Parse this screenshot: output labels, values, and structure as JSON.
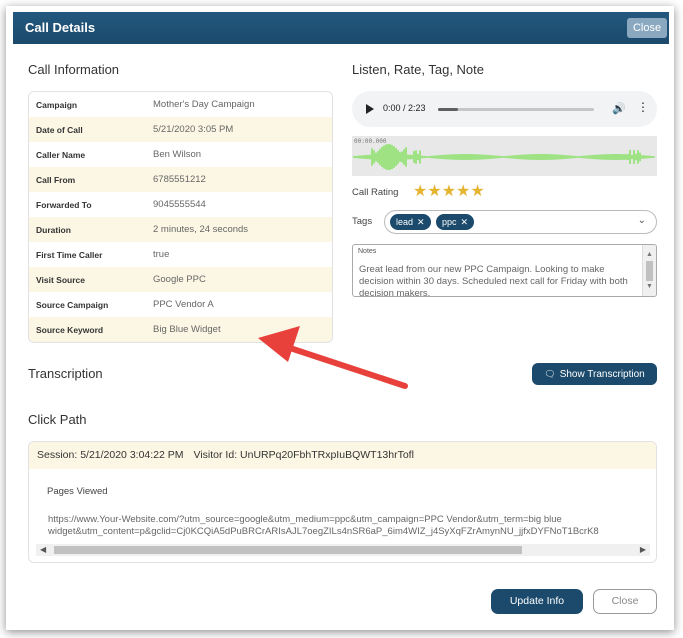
{
  "window": {
    "title": "Call Details",
    "close_label": "Close"
  },
  "call_info": {
    "title": "Call Information",
    "rows": [
      {
        "label": "Campaign",
        "value": "Mother's Day Campaign"
      },
      {
        "label": "Date of Call",
        "value": "5/21/2020 3:05 PM"
      },
      {
        "label": "Caller Name",
        "value": "Ben Wilson"
      },
      {
        "label": "Call From",
        "value": "6785551212"
      },
      {
        "label": "Forwarded To",
        "value": "9045555544"
      },
      {
        "label": "Duration",
        "value": "2 minutes, 24 seconds"
      },
      {
        "label": "First Time Caller",
        "value": "true"
      },
      {
        "label": "Visit Source",
        "value": "Google PPC"
      },
      {
        "label": "Source Campaign",
        "value": "PPC Vendor A"
      },
      {
        "label": "Source Keyword",
        "value": "Big Blue Widget"
      }
    ]
  },
  "listen": {
    "title": "Listen, Rate, Tag, Note",
    "player_time": "0:00 / 2:23",
    "progress": 0.13,
    "waveform_timestamp": "00:00.000",
    "rating_label": "Call Rating",
    "rating": 5,
    "stars": "★★★★★",
    "tags_label": "Tags",
    "tags": [
      "lead",
      "ppc"
    ],
    "notes_label": "Notes",
    "notes_text": "Great lead from our new PPC Campaign.  Looking to make decision within 30 days.  Scheduled next call for Friday with both decision makers."
  },
  "transcription": {
    "title": "Transcription",
    "button_label": "Show Transcription"
  },
  "click_path": {
    "title": "Click Path",
    "session": "Session: 5/21/2020 3:04:22 PM",
    "visitor": "Visitor Id: UnURPq20FbhTRxpIuBQWT13hrTofl",
    "pages_label": "Pages Viewed",
    "url": "https://www.Your-Website.com/?utm_source=google&utm_medium=ppc&utm_campaign=PPC Vendor&utm_term=big blue\nwidget&utm_content=p&gclid=Cj0KCQiA5dPuBRCrARIsAJL7oegZILs4nSR6aP_6im4WIZ_j4SyXqFZrAmynNU_jjfxDYFNoT1BcrK8"
  },
  "footer": {
    "update_label": "Update Info",
    "close_label": "Close"
  },
  "colors": {
    "brand": "#1b4a6c",
    "row_alt": "#fcf7e4",
    "star": "#e5b431",
    "wave": "#7fe05a",
    "arrow": "#e8413c"
  }
}
